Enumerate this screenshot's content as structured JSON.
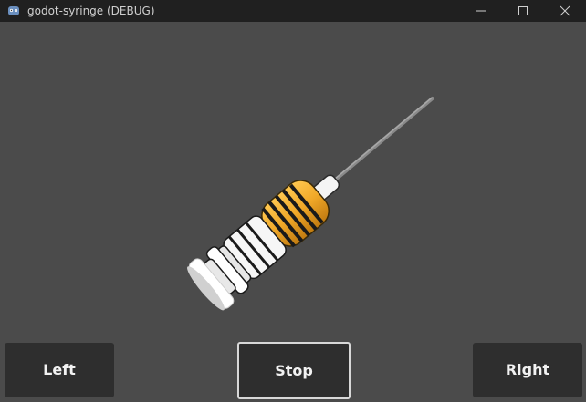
{
  "window": {
    "title": "godot-syringe (DEBUG)"
  },
  "controls": {
    "left_label": "Left",
    "stop_label": "Stop",
    "right_label": "Right"
  },
  "colors": {
    "background": "#4b4b4b",
    "titlebar": "#202020",
    "barrel": "#f0a828",
    "button": "#2e2e2e"
  },
  "icons": {
    "app": "godot-icon",
    "minimize": "minimize-icon",
    "maximize": "maximize-icon",
    "close": "close-icon"
  }
}
